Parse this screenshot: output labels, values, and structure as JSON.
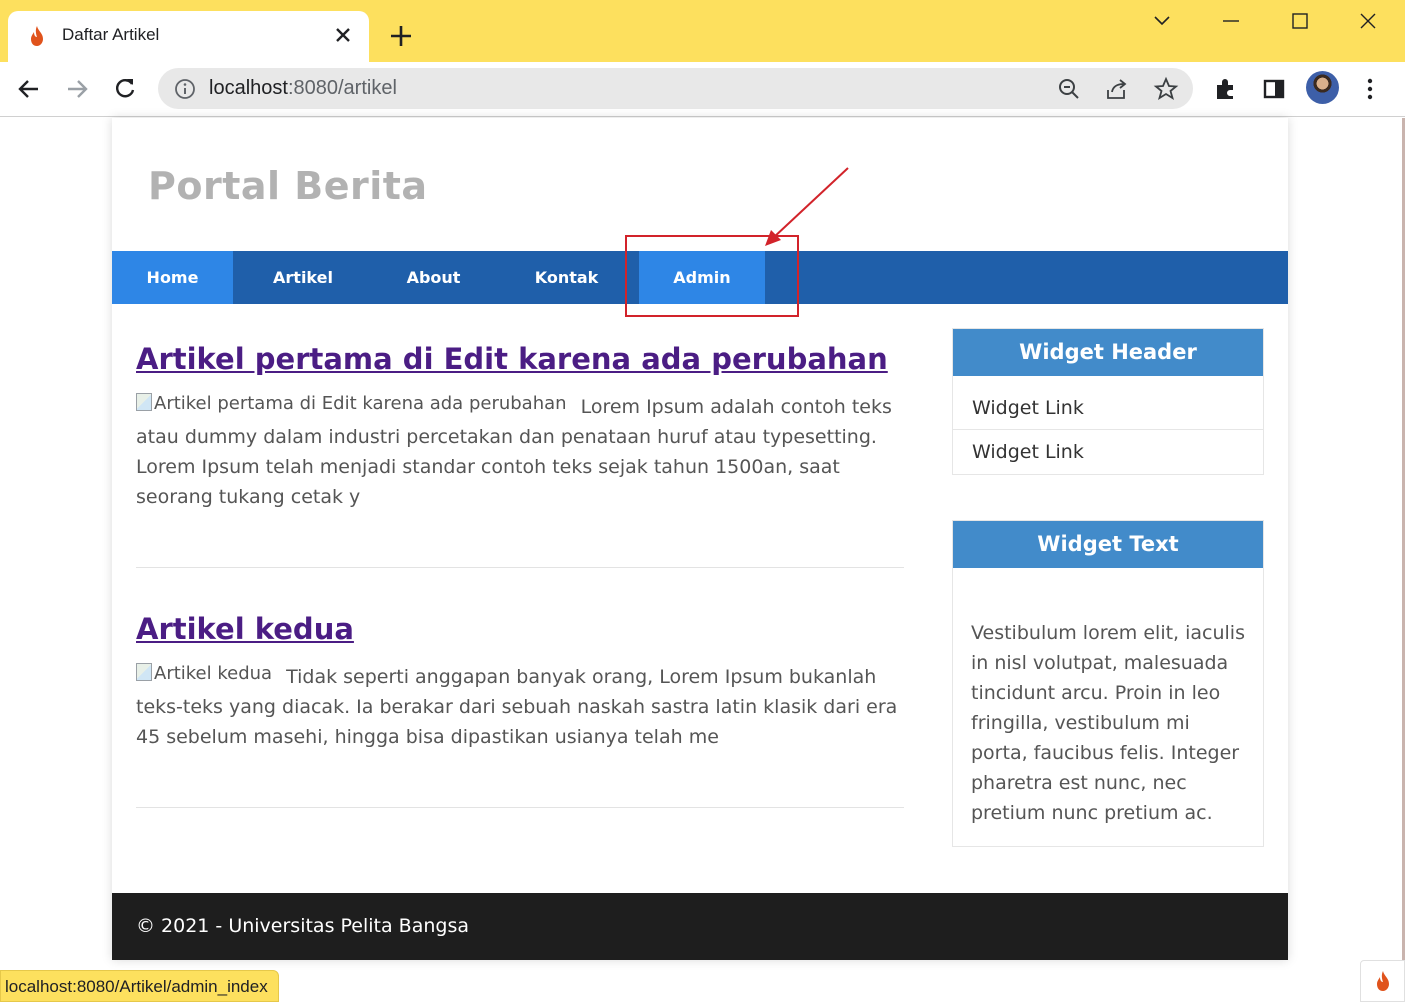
{
  "browser": {
    "tab_title": "Daftar Artikel",
    "url_host": "localhost",
    "url_path": ":8080/artikel",
    "status_url": "localhost:8080/Artikel/admin_index"
  },
  "site": {
    "title": "Portal Berita",
    "nav": [
      {
        "label": "Home",
        "active": false
      },
      {
        "label": "Artikel",
        "active": false
      },
      {
        "label": "About",
        "active": false
      },
      {
        "label": "Kontak",
        "active": false
      },
      {
        "label": "Admin",
        "active": true
      }
    ],
    "articles": [
      {
        "title": "Artikel pertama di Edit karena ada perubahan",
        "image_alt": "Artikel pertama di Edit karena ada perubahan",
        "excerpt": "Lorem Ipsum adalah contoh teks atau dummy dalam industri percetakan dan penataan huruf atau typesetting. Lorem Ipsum telah menjadi standar contoh teks sejak tahun 1500an, saat seorang tukang cetak y"
      },
      {
        "title": "Artikel kedua",
        "image_alt": "Artikel kedua",
        "excerpt": "Tidak seperti anggapan banyak orang, Lorem Ipsum bukanlah teks-teks yang diacak. Ia berakar dari sebuah naskah sastra latin klasik dari era 45 sebelum masehi, hingga bisa dipastikan usianya telah me"
      }
    ],
    "widget_links": {
      "header": "Widget Header",
      "links": [
        "Widget Link",
        "Widget Link"
      ]
    },
    "widget_text": {
      "header": "Widget Text",
      "body": "Vestibulum lorem elit, iaculis in nisl volutpat, malesuada tincidunt arcu. Proin in leo fringilla, vestibulum mi porta, faucibus felis. Integer pharetra est nunc, nec pretium nunc pretium ac."
    },
    "footer": "© 2021 - Universitas Pelita Bangsa"
  },
  "colors": {
    "chrome_frame": "#fde05e",
    "nav_bg": "#1f5faa",
    "nav_active": "#2e86e6",
    "widget_header": "#428bca",
    "footer_bg": "#1e1e1e",
    "annotation": "#d2232a"
  },
  "icons": [
    "flame-icon",
    "close-icon",
    "plus-icon",
    "chevron-down-icon",
    "minimize-icon",
    "maximize-icon",
    "window-close-icon",
    "back-icon",
    "forward-icon",
    "reload-icon",
    "info-icon",
    "zoom-icon",
    "share-icon",
    "star-icon",
    "extensions-icon",
    "side-panel-icon",
    "more-icon"
  ]
}
